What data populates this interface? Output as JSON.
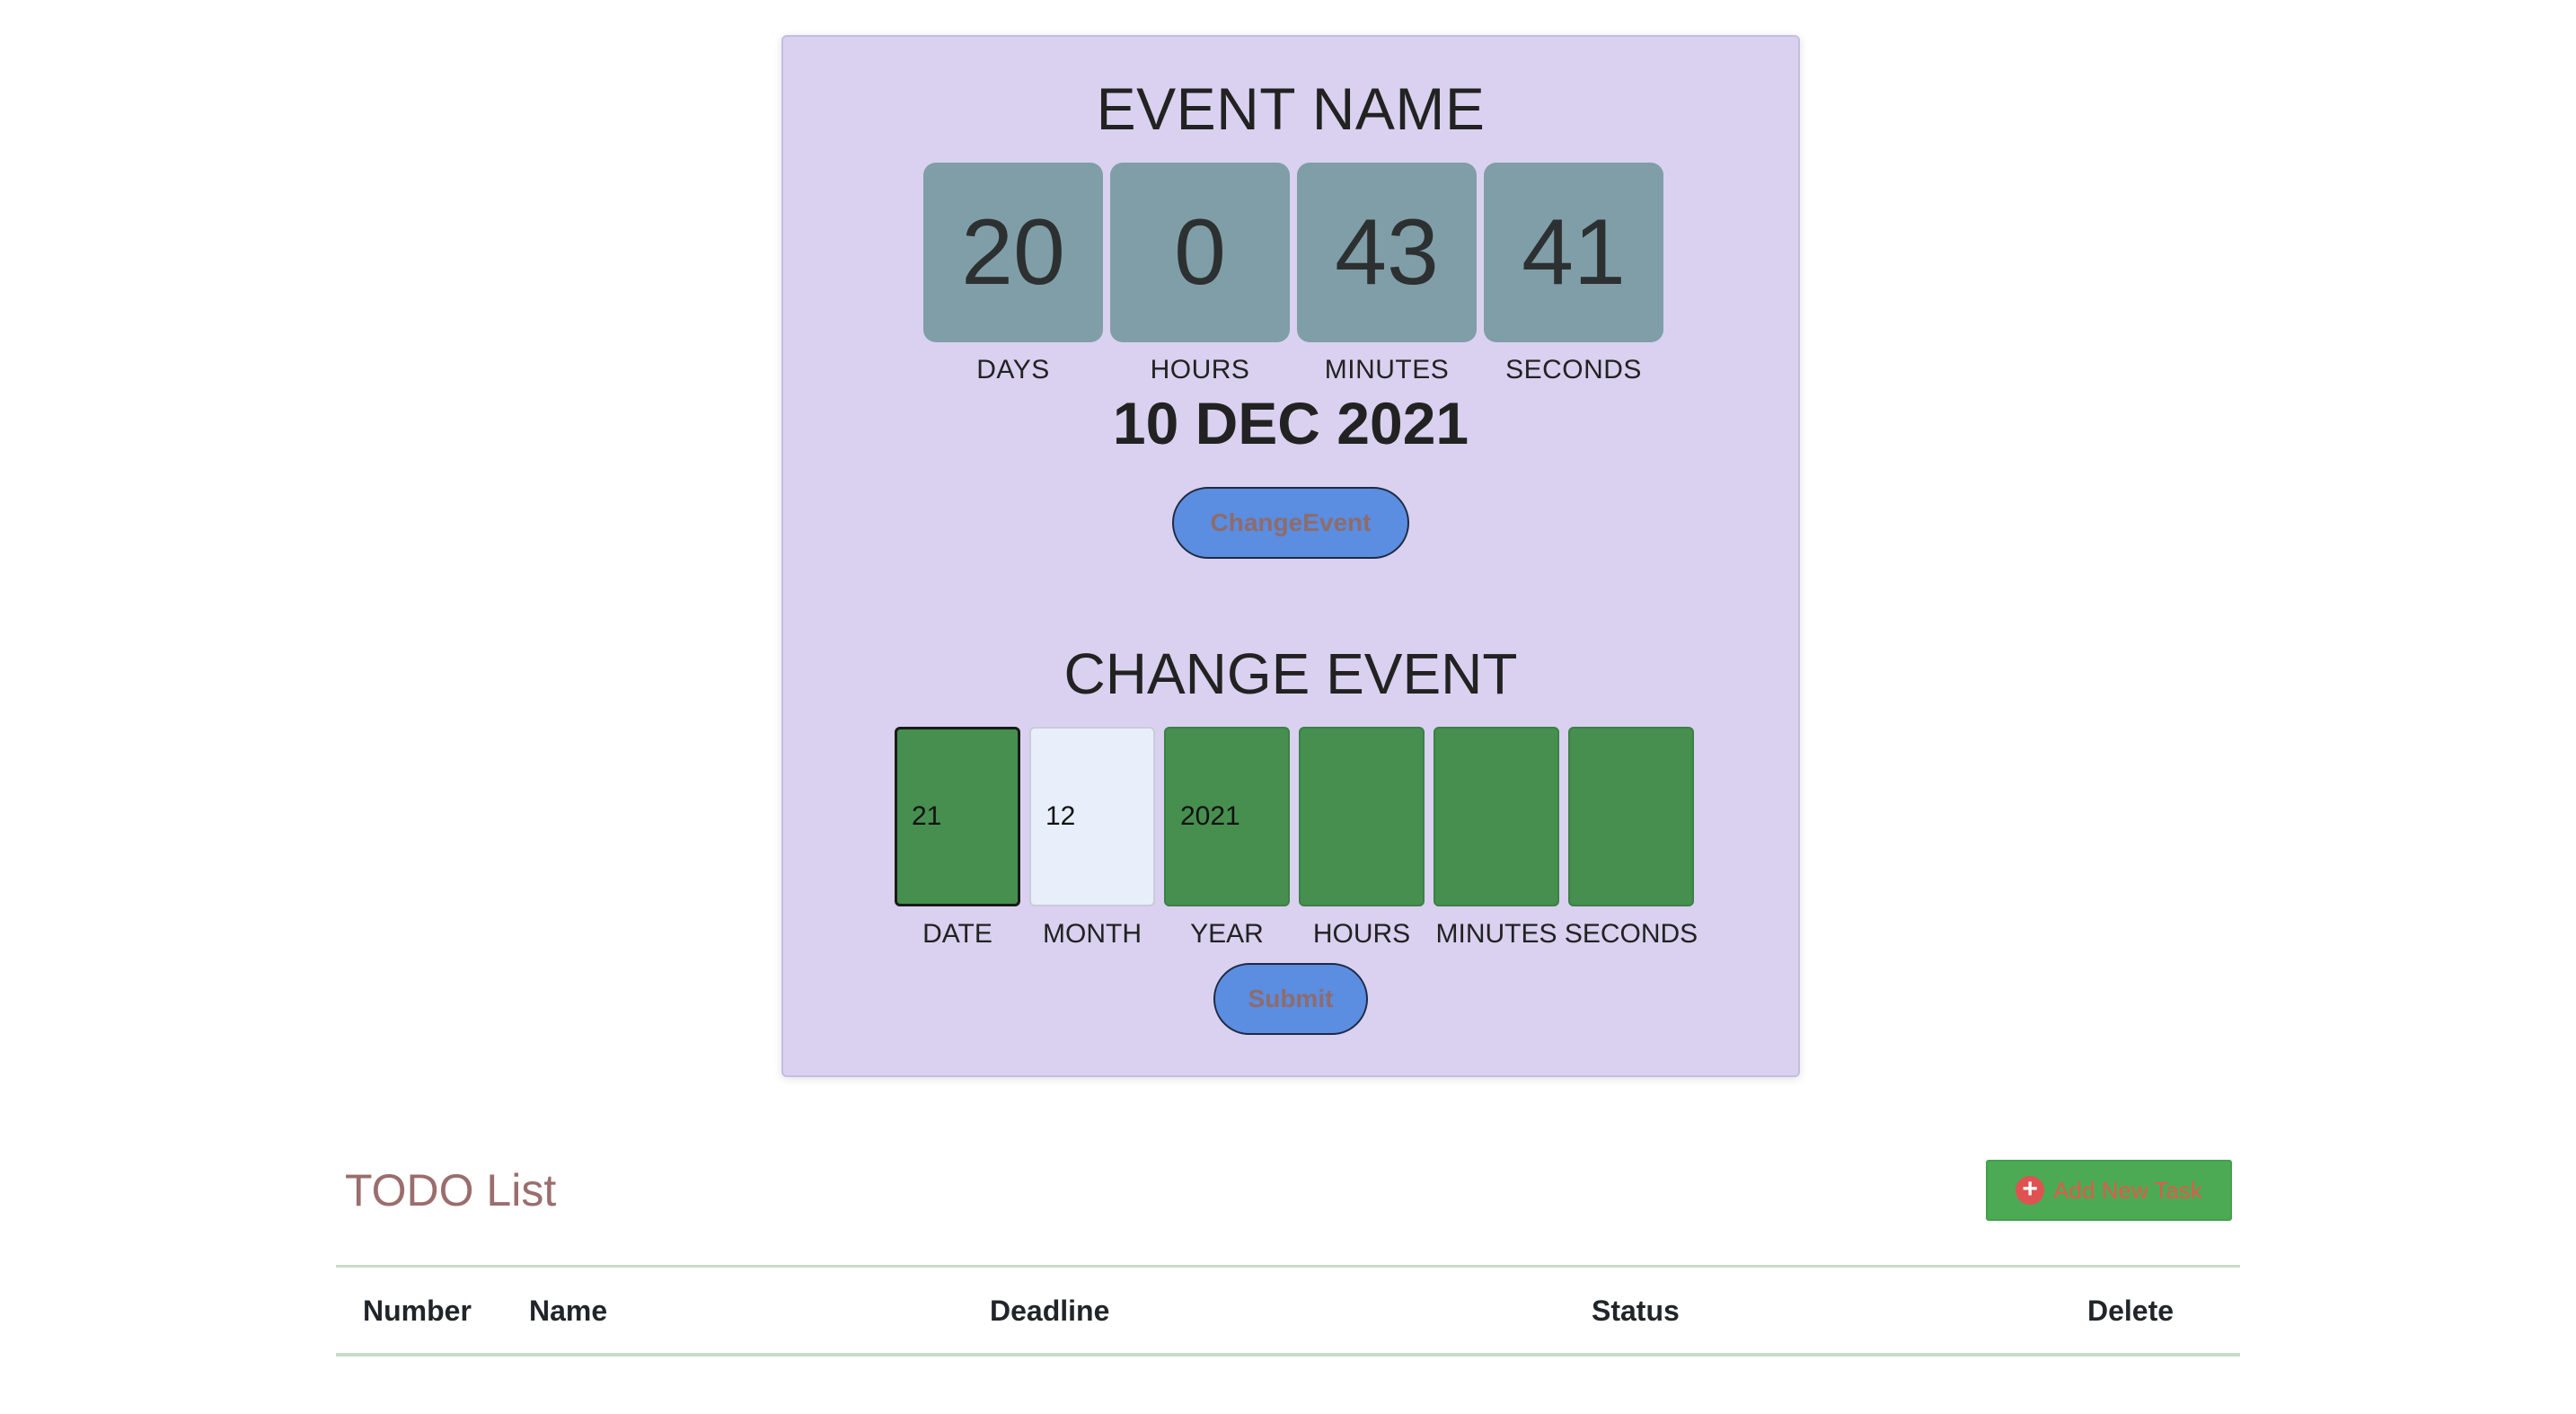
{
  "countdown": {
    "event_name": "EVENT NAME",
    "tiles": [
      {
        "value": "20",
        "label": "DAYS"
      },
      {
        "value": "0",
        "label": "HOURS"
      },
      {
        "value": "43",
        "label": "MINUTES"
      },
      {
        "value": "41",
        "label": "SECONDS"
      }
    ],
    "event_date": "10 DEC 2021",
    "change_button_label": "ChangeEvent"
  },
  "change_event": {
    "title": "CHANGE EVENT",
    "fields": [
      {
        "label": "DATE",
        "value": "21"
      },
      {
        "label": "MONTH",
        "value": "12"
      },
      {
        "label": "YEAR",
        "value": "2021"
      },
      {
        "label": "HOURS",
        "value": ""
      },
      {
        "label": "MINUTES",
        "value": ""
      },
      {
        "label": "SECONDS",
        "value": ""
      }
    ],
    "submit_label": "Submit"
  },
  "todo": {
    "title": "TODO List",
    "add_button_label": "Add New Task",
    "add_icon": "plus-circle-icon",
    "columns": [
      "Number",
      "Name",
      "Deadline",
      "Status",
      "Delete"
    ]
  },
  "colors": {
    "card_background": "#d9d1ef",
    "tile_background": "#7f9ea8",
    "input_green": "#468f4f",
    "button_blue": "#5b8de0",
    "add_button_green": "#4caa55",
    "todo_title": "#9b6d6d"
  }
}
